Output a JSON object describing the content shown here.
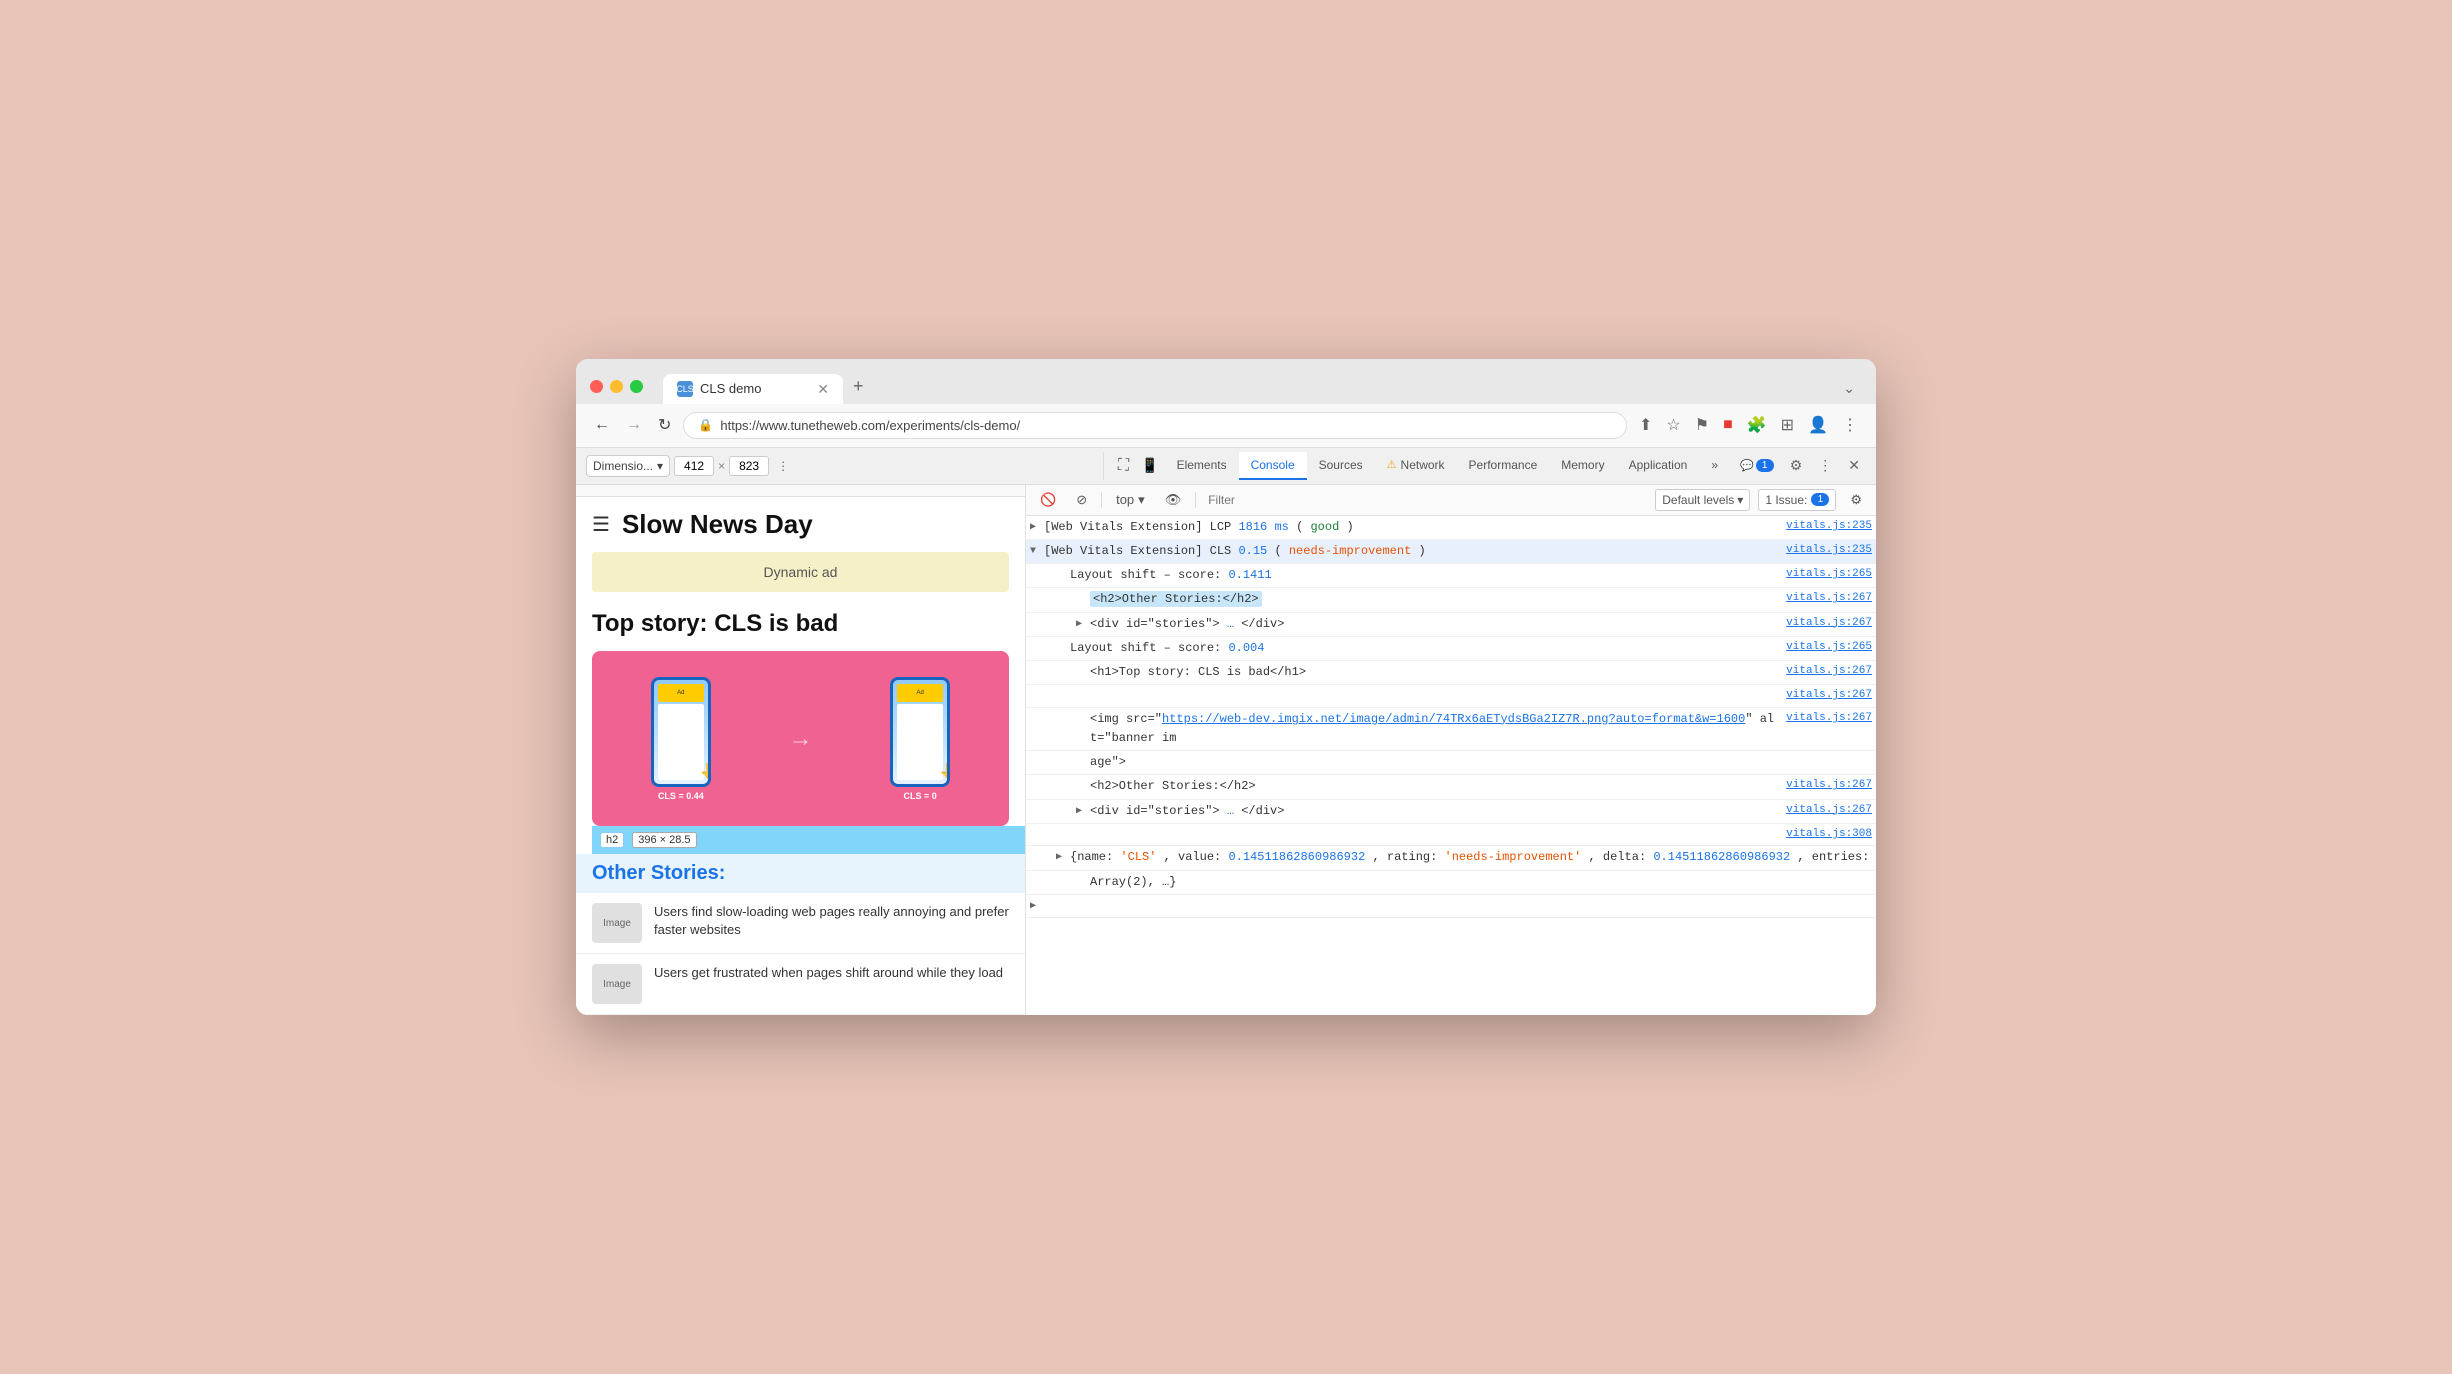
{
  "browser": {
    "tab_title": "CLS demo",
    "tab_favicon": "CLS",
    "url": "https://www.tunetheweb.com/experiments/cls-demo/",
    "new_tab_label": "+",
    "more_label": "⌄"
  },
  "nav": {
    "back": "←",
    "forward": "→",
    "refresh": "↻",
    "lock": "🔒",
    "share": "↑",
    "bookmark": "☆",
    "flag": "⚑",
    "record": "■",
    "extensions": "🧩",
    "sidebar": "⊞",
    "profile": "👤",
    "more": "⋮"
  },
  "devtools_responsive": {
    "dimension_label": "Dimensio...",
    "width": "412",
    "height": "823",
    "more": "⋮"
  },
  "devtools_tabs": {
    "inspect_icon": "⛶",
    "mobile_icon": "📱",
    "tabs": [
      {
        "label": "Elements",
        "active": false
      },
      {
        "label": "Console",
        "active": true
      },
      {
        "label": "Sources",
        "active": false
      },
      {
        "label": "Network",
        "active": false,
        "warning": true
      },
      {
        "label": "Performance",
        "active": false
      },
      {
        "label": "Memory",
        "active": false
      },
      {
        "label": "Application",
        "active": false
      }
    ],
    "more": "»",
    "badge_count": "1",
    "settings_icon": "⚙",
    "more_icon": "⋮",
    "close_icon": "✕"
  },
  "console_toolbar": {
    "clear_icon": "🚫",
    "stop_icon": "⊘",
    "context_label": "top",
    "context_arrow": "▾",
    "eye_icon": "👁",
    "filter_placeholder": "Filter",
    "default_levels": "Default levels",
    "default_levels_arrow": "▾",
    "issues_label": "1 Issue:",
    "issues_badge": "1",
    "settings_icon": "⚙"
  },
  "console_entries": [
    {
      "id": "lcp",
      "expandable": false,
      "indent": 0,
      "parts": [
        {
          "text": "[Web Vitals Extension] LCP ",
          "class": ""
        },
        {
          "text": "1816 ms",
          "class": "c-blue"
        },
        {
          "text": " (",
          "class": ""
        },
        {
          "text": "good",
          "class": "c-green"
        },
        {
          "text": ")",
          "class": ""
        }
      ],
      "link": "vitals.js:235",
      "highlight": false
    },
    {
      "id": "cls-main",
      "expandable": true,
      "expanded": true,
      "indent": 0,
      "parts": [
        {
          "text": "[Web Vitals Extension] CLS ",
          "class": ""
        },
        {
          "text": "0.15",
          "class": "c-blue"
        },
        {
          "text": " (",
          "class": ""
        },
        {
          "text": "needs-improvement",
          "class": "c-orange"
        },
        {
          "text": ")",
          "class": ""
        }
      ],
      "link": "vitals.js:235",
      "highlight": true
    },
    {
      "id": "layout-shift-1",
      "expandable": false,
      "indent": 1,
      "parts": [
        {
          "text": "Layout shift – score: ",
          "class": ""
        },
        {
          "text": "0.1411",
          "class": "c-blue"
        }
      ],
      "link": "vitals.js:265",
      "highlight": false
    },
    {
      "id": "h2-other",
      "expandable": false,
      "indent": 2,
      "parts": [
        {
          "text": "<h2>Other Stories:</h2>",
          "class": "code-tag",
          "has_highlight": true
        }
      ],
      "link": "vitals.js:267",
      "highlight": false
    },
    {
      "id": "div-stories-1",
      "expandable": true,
      "expanded": false,
      "indent": 2,
      "parts": [
        {
          "text": "<div id=\"stories\">",
          "class": "code-tag"
        },
        {
          "text": " … ",
          "class": "c-blue"
        },
        {
          "text": "</div>",
          "class": "code-tag"
        }
      ],
      "link": "vitals.js:267",
      "highlight": false
    },
    {
      "id": "layout-shift-2",
      "expandable": false,
      "indent": 1,
      "parts": [
        {
          "text": "Layout shift – score: ",
          "class": ""
        },
        {
          "text": "0.004",
          "class": "c-blue"
        }
      ],
      "link": "vitals.js:265",
      "highlight": false
    },
    {
      "id": "h1-top-story",
      "expandable": false,
      "indent": 2,
      "parts": [
        {
          "text": "<h1>Top story: CLS is bad</h1>",
          "class": "code-tag"
        }
      ],
      "link": "vitals.js:267",
      "highlight": false
    },
    {
      "id": "empty-row",
      "expandable": false,
      "indent": 0,
      "parts": [
        {
          "text": "",
          "class": ""
        }
      ],
      "link": "vitals.js:267",
      "highlight": false
    },
    {
      "id": "img-src",
      "expandable": false,
      "indent": 2,
      "parts": [
        {
          "text": "<img src=\"",
          "class": "code-tag"
        },
        {
          "text": "https://web-dev.imgix.net/image/admin/74TRx6aETydsBGa2IZ7R.png?auto=format&w=1600",
          "class": "code-link"
        },
        {
          "text": "\" alt=\"banner im",
          "class": "code-tag"
        }
      ],
      "link": "vitals.js:267",
      "highlight": false,
      "continued": true,
      "continued_text": "age\">"
    },
    {
      "id": "h2-other-2",
      "expandable": false,
      "indent": 2,
      "parts": [
        {
          "text": "<h2>Other Stories:</h2>",
          "class": "code-tag"
        }
      ],
      "link": "vitals.js:267",
      "highlight": false
    },
    {
      "id": "div-stories-2",
      "expandable": true,
      "expanded": false,
      "indent": 2,
      "parts": [
        {
          "text": "<div id=\"stories\">",
          "class": "code-tag"
        },
        {
          "text": " … ",
          "class": "c-blue"
        },
        {
          "text": "</div>",
          "class": "code-tag"
        }
      ],
      "link": "vitals.js:267",
      "highlight": false
    },
    {
      "id": "vitals-308",
      "expandable": false,
      "indent": 0,
      "parts": [
        {
          "text": "",
          "class": ""
        }
      ],
      "link": "vitals.js:308",
      "highlight": false
    },
    {
      "id": "cls-object",
      "expandable": true,
      "expanded": false,
      "indent": 1,
      "parts": [
        {
          "text": "{name: ",
          "class": ""
        },
        {
          "text": "'CLS'",
          "class": "c-orange"
        },
        {
          "text": ", value: ",
          "class": ""
        },
        {
          "text": "0.14511862860986932",
          "class": "c-blue"
        },
        {
          "text": ", rating: ",
          "class": ""
        },
        {
          "text": "'needs-improvement'",
          "class": "c-orange"
        },
        {
          "text": ", delta: ",
          "class": ""
        },
        {
          "text": "0.14511862860986932",
          "class": "c-blue"
        },
        {
          "text": ", entries:",
          "class": ""
        }
      ],
      "link": "",
      "highlight": false
    },
    {
      "id": "cls-object-2",
      "expandable": false,
      "indent": 2,
      "parts": [
        {
          "text": "Array(2), …}",
          "class": ""
        }
      ],
      "link": "",
      "highlight": false
    },
    {
      "id": "expand-bottom",
      "expandable": true,
      "expanded": false,
      "indent": 0,
      "parts": [
        {
          "text": "",
          "class": ""
        }
      ],
      "link": "",
      "highlight": false
    }
  ],
  "viewport": {
    "site_title": "Slow News Day",
    "dynamic_ad": "Dynamic ad",
    "article_title": "Top story: CLS is bad",
    "cls_bad": "CLS = 0.44",
    "cls_good": "CLS = 0",
    "h2_badge": "h2",
    "element_size": "396 × 28.5",
    "other_stories_heading": "Other Stories:",
    "news_items": [
      {
        "thumb": "Image",
        "text": "Users find slow-loading web pages really annoying and prefer faster websites"
      },
      {
        "thumb": "Image",
        "text": "Users get frustrated when pages shift around while they load"
      }
    ]
  }
}
